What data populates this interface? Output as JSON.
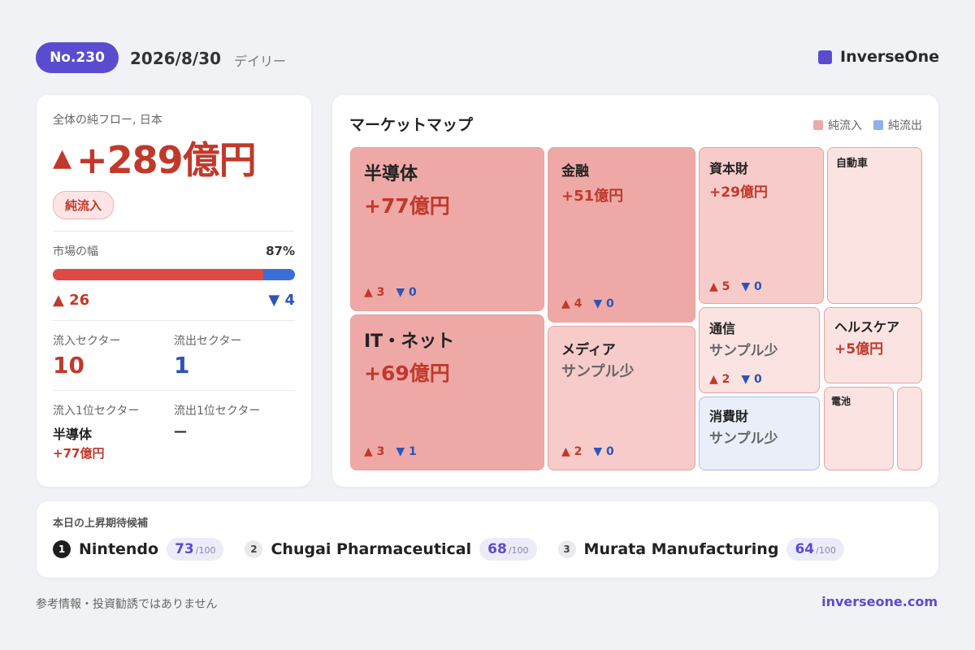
{
  "header": {
    "issue": "No.230",
    "date": "2026/8/30",
    "frequency": "デイリー",
    "brand": "InverseOne",
    "brand_color": "#5b4ccf"
  },
  "summary": {
    "label": "全体の純フロー, 日本",
    "arrow": "▲",
    "value": "+289億円",
    "pill": "純流入",
    "breadth_label": "市場の幅",
    "breadth_value": "87%",
    "breadth_fraction": 0.87,
    "up_count": "▲ 26",
    "down_count": "▼ 4",
    "inflow_sectors_label": "流入セクター",
    "inflow_sectors": "10",
    "outflow_sectors_label": "流出セクター",
    "outflow_sectors": "1",
    "top_inflow_label": "流入1位セクター",
    "top_inflow_name": "半導体",
    "top_inflow_value": "+77億円",
    "top_outflow_label": "流出1位セクター",
    "top_outflow_name": "—"
  },
  "market_map": {
    "title": "マーケットマップ",
    "legend_inflow": "純流入",
    "legend_outflow": "純流出",
    "inflow_color": "#eea9a6",
    "outflow_color": "#8fb0ea",
    "tiles": {
      "semis": {
        "name": "半導体",
        "value": "+77億円",
        "up": "▲ 3",
        "down": "▼ 0"
      },
      "it": {
        "name": "IT・ネット",
        "value": "+69億円",
        "up": "▲ 3",
        "down": "▼ 1"
      },
      "finance": {
        "name": "金融",
        "value": "+51億円",
        "up": "▲ 4",
        "down": "▼ 0"
      },
      "media": {
        "name": "メディア",
        "value": "サンプル少",
        "up": "▲ 2",
        "down": "▼ 0"
      },
      "capital": {
        "name": "資本財",
        "value": "+29億円",
        "up": "▲ 5",
        "down": "▼ 0"
      },
      "auto": {
        "name": "自動車"
      },
      "telecom": {
        "name": "通信",
        "value": "サンプル少",
        "up": "▲ 2",
        "down": "▼ 0"
      },
      "health": {
        "name": "ヘルスケア",
        "value": "+5億円"
      },
      "consumer": {
        "name": "消費財",
        "value": "サンプル少"
      },
      "battery": {
        "name": "電池"
      }
    }
  },
  "candidates": {
    "title": "本日の上昇期待候補",
    "items": [
      {
        "rank": "1",
        "name": "Nintendo",
        "score": "73",
        "max": "/100"
      },
      {
        "rank": "2",
        "name": "Chugai Pharmaceutical",
        "score": "68",
        "max": "/100"
      },
      {
        "rank": "3",
        "name": "Murata Manufacturing",
        "score": "64",
        "max": "/100"
      }
    ]
  },
  "footer": {
    "disclaimer": "参考情報・投資勧誘ではありません",
    "url": "inverseone.com"
  }
}
